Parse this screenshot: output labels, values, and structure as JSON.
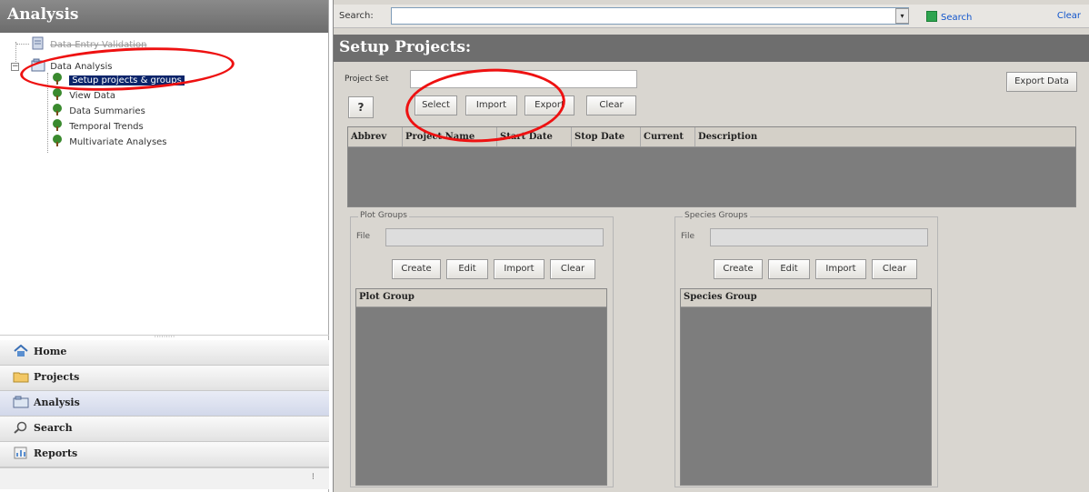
{
  "left_panel": {
    "title": "Analysis",
    "tree": {
      "faded_item": "Data Entry Validation",
      "root": "Data Analysis",
      "children": [
        "Setup projects & groups",
        "View Data",
        "Data Summaries",
        "Temporal Trends",
        "Multivariate Analyses"
      ],
      "expander": "−"
    },
    "splitter": "·········",
    "nav": [
      {
        "label": "Home",
        "icon": "home-icon"
      },
      {
        "label": "Projects",
        "icon": "projects-icon"
      },
      {
        "label": "Analysis",
        "icon": "analysis-icon"
      },
      {
        "label": "Search",
        "icon": "search-icon"
      },
      {
        "label": "Reports",
        "icon": "reports-icon"
      }
    ],
    "footer_grip": "⁝"
  },
  "search_bar": {
    "label": "Search:",
    "value": "",
    "dropdown": "▾",
    "go_label": "Search",
    "clear_label": "Clear"
  },
  "setup": {
    "title": "Setup Projects:",
    "project_set_label": "Project Set",
    "project_set_value": "",
    "export_data": "Export Data",
    "help": "?",
    "buttons": {
      "select": "Select",
      "import": "Import",
      "export": "Export",
      "clear": "Clear"
    },
    "table_columns": [
      "Abbrev",
      "Project Name",
      "Start Date",
      "Stop Date",
      "Current",
      "Description"
    ]
  },
  "plot_groups": {
    "legend": "Plot Groups",
    "file_label": "File",
    "buttons": {
      "create": "Create",
      "edit": "Edit",
      "import": "Import",
      "clear": "Clear"
    },
    "column": "Plot Group"
  },
  "species_groups": {
    "legend": "Species Groups",
    "file_label": "File",
    "buttons": {
      "create": "Create",
      "edit": "Edit",
      "import": "Import",
      "clear": "Clear"
    },
    "column": "Species Group"
  },
  "colors": {
    "annotation": "#ee1111",
    "selected_node": "#0a246a",
    "header_gray": "#6e6e6e",
    "panel_bg": "#d9d6d0"
  }
}
